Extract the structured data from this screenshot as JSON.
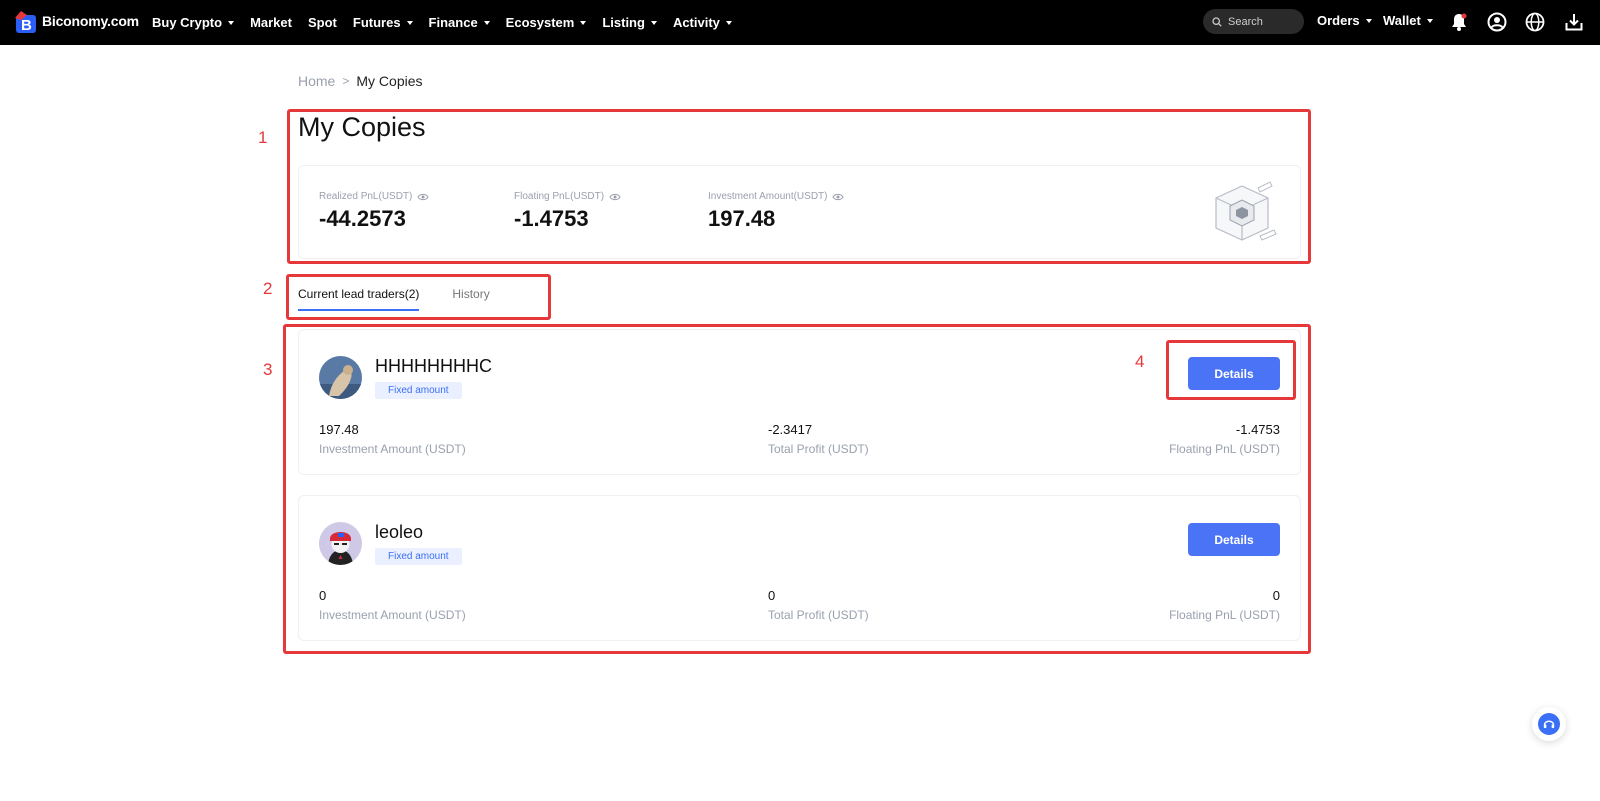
{
  "header": {
    "logo_text": "Biconomy.com",
    "nav": [
      {
        "label": "Buy Crypto",
        "has_dropdown": true
      },
      {
        "label": "Market",
        "has_dropdown": false
      },
      {
        "label": "Spot",
        "has_dropdown": false
      },
      {
        "label": "Futures",
        "has_dropdown": true
      },
      {
        "label": "Finance",
        "has_dropdown": true
      },
      {
        "label": "Ecosystem",
        "has_dropdown": true
      },
      {
        "label": "Listing",
        "has_dropdown": true
      },
      {
        "label": "Activity",
        "has_dropdown": true
      }
    ],
    "search_placeholder": "Search",
    "orders_label": "Orders",
    "wallet_label": "Wallet",
    "icons": [
      "bell-icon",
      "user-icon",
      "globe-icon",
      "download-icon"
    ]
  },
  "breadcrumb": {
    "home": "Home",
    "separator": ">",
    "current": "My Copies"
  },
  "annotations": {
    "m1": "1",
    "m2": "2",
    "m3": "3",
    "m4": "4",
    "color": "#e5383b"
  },
  "summary": {
    "title": "My Copies",
    "stats": [
      {
        "label": "Realized PnL(USDT)",
        "value": "-44.2573"
      },
      {
        "label": "Floating PnL(USDT)",
        "value": "-1.4753"
      },
      {
        "label": "Investment Amount(USDT)",
        "value": "197.48"
      }
    ]
  },
  "tabs": {
    "current": "Current lead traders(2)",
    "history": "History"
  },
  "traders": [
    {
      "name": "HHHHHHHHC",
      "tag": "Fixed amount",
      "details_label": "Details",
      "investment": {
        "value": "197.48",
        "label": "Investment Amount (USDT)"
      },
      "total_profit": {
        "value": "-2.3417",
        "label": "Total Profit (USDT)"
      },
      "floating_pnl": {
        "value": "-1.4753",
        "label": "Floating PnL (USDT)"
      }
    },
    {
      "name": "leoleo",
      "tag": "Fixed amount",
      "details_label": "Details",
      "investment": {
        "value": "0",
        "label": "Investment Amount (USDT)"
      },
      "total_profit": {
        "value": "0",
        "label": "Total Profit (USDT)"
      },
      "floating_pnl": {
        "value": "0",
        "label": "Floating PnL (USDT)"
      }
    }
  ],
  "colors": {
    "accent": "#4a73f5",
    "tab_underline": "#3b6ff5",
    "tag_bg": "#eaf0ff",
    "muted": "#9aa0ae"
  }
}
